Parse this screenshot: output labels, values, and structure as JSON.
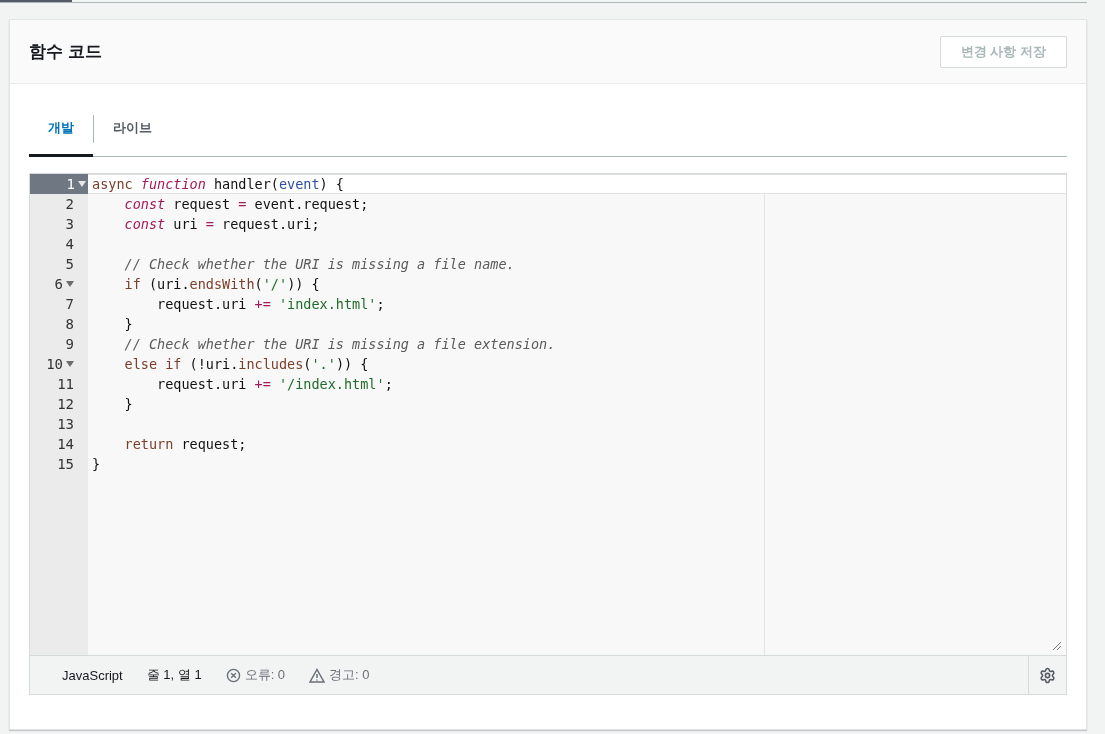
{
  "panel": {
    "title": "함수 코드",
    "save_button": {
      "label": "변경 사항 저장",
      "disabled": true
    }
  },
  "tabs": [
    {
      "label": "개발",
      "selected": true
    },
    {
      "label": "라이브",
      "selected": false
    }
  ],
  "editor": {
    "lines": [
      {
        "number": "1",
        "foldable": true,
        "selected": true,
        "tokens": [
          {
            "kind": "kw",
            "t": "async "
          },
          {
            "kind": "storage",
            "t": "function"
          },
          {
            "kind": "text",
            "t": " handler("
          },
          {
            "kind": "param",
            "t": "event"
          },
          {
            "kind": "text",
            "t": ") {"
          }
        ]
      },
      {
        "number": "2",
        "foldable": false,
        "selected": false,
        "tokens": [
          {
            "kind": "storage",
            "t": "    const"
          },
          {
            "kind": "text",
            "t": " request "
          },
          {
            "kind": "op",
            "t": "="
          },
          {
            "kind": "text",
            "t": " event.request;"
          }
        ]
      },
      {
        "number": "3",
        "foldable": false,
        "selected": false,
        "tokens": [
          {
            "kind": "storage",
            "t": "    const"
          },
          {
            "kind": "text",
            "t": " uri "
          },
          {
            "kind": "op",
            "t": "="
          },
          {
            "kind": "text",
            "t": " request.uri;"
          }
        ]
      },
      {
        "number": "4",
        "foldable": false,
        "selected": false
      },
      {
        "number": "5",
        "foldable": false,
        "selected": false,
        "tokens": [
          {
            "kind": "comment",
            "t": "    // Check whether the URI is missing a file name."
          }
        ]
      },
      {
        "number": "6",
        "foldable": true,
        "selected": false,
        "tokens": [
          {
            "kind": "kw",
            "t": "    if"
          },
          {
            "kind": "text",
            "t": " (uri."
          },
          {
            "kind": "kw",
            "t": "endsWith"
          },
          {
            "kind": "text",
            "t": "("
          },
          {
            "kind": "string",
            "t": "'/'"
          },
          {
            "kind": "text",
            "t": ")) {"
          }
        ]
      },
      {
        "number": "7",
        "foldable": false,
        "selected": false,
        "tokens": [
          {
            "kind": "text",
            "t": "        request.uri "
          },
          {
            "kind": "op",
            "t": "+="
          },
          {
            "kind": "string",
            "t": " 'index.html'"
          },
          {
            "kind": "text",
            "t": ";"
          }
        ]
      },
      {
        "number": "8",
        "foldable": false,
        "selected": false,
        "tokens": [
          {
            "kind": "text",
            "t": "    }"
          }
        ]
      },
      {
        "number": "9",
        "foldable": false,
        "selected": false,
        "tokens": [
          {
            "kind": "comment",
            "t": "    // Check whether the URI is missing a file extension."
          }
        ]
      },
      {
        "number": "10",
        "foldable": true,
        "selected": false,
        "tokens": [
          {
            "kind": "kw",
            "t": "    else if"
          },
          {
            "kind": "text",
            "t": " (!uri."
          },
          {
            "kind": "kw",
            "t": "includes"
          },
          {
            "kind": "text",
            "t": "("
          },
          {
            "kind": "string",
            "t": "'.'"
          },
          {
            "kind": "text",
            "t": ")) {"
          }
        ]
      },
      {
        "number": "11",
        "foldable": false,
        "selected": false,
        "tokens": [
          {
            "kind": "text",
            "t": "        request.uri "
          },
          {
            "kind": "op",
            "t": "+="
          },
          {
            "kind": "string",
            "t": " '/index.html'"
          },
          {
            "kind": "text",
            "t": ";"
          }
        ]
      },
      {
        "number": "12",
        "foldable": false,
        "selected": false,
        "tokens": [
          {
            "kind": "text",
            "t": "    }"
          }
        ]
      },
      {
        "number": "13",
        "foldable": false,
        "selected": false
      },
      {
        "number": "14",
        "foldable": false,
        "selected": false,
        "tokens": [
          {
            "kind": "kw",
            "t": "    return"
          },
          {
            "kind": "text",
            "t": " request;"
          }
        ]
      },
      {
        "number": "15",
        "foldable": false,
        "selected": false,
        "tokens": [
          {
            "kind": "text",
            "t": "}"
          }
        ]
      }
    ]
  },
  "status_bar": {
    "language": "JavaScript",
    "position": "줄 1, 열 1",
    "errors": "오류: 0",
    "warnings": "경고: 0"
  }
}
